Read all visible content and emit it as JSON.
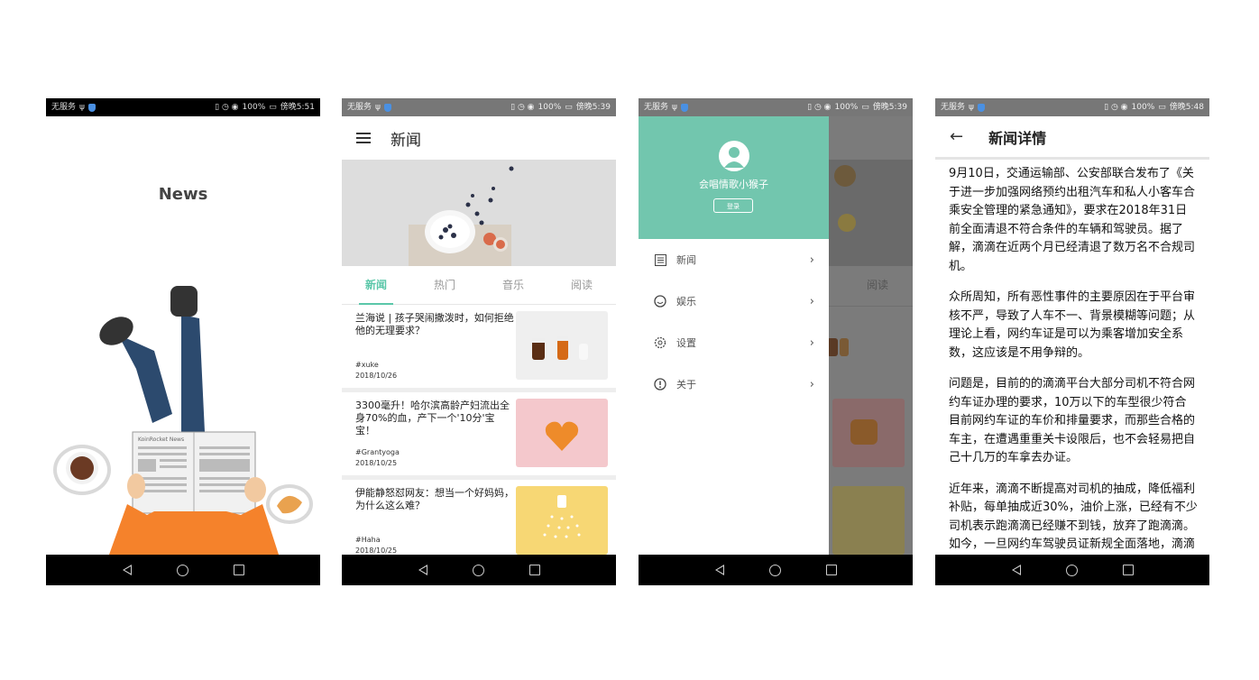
{
  "screens": {
    "splash": {
      "status": {
        "left": "无服务",
        "right": "100%",
        "time": "傍晚5:51"
      },
      "title": "News",
      "illustration_text": "KoinRocket News"
    },
    "news_list": {
      "status": {
        "left": "无服务",
        "right": "100%",
        "time": "傍晚5:39"
      },
      "title": "新闻",
      "tabs": [
        "新闻",
        "热门",
        "音乐",
        "阅读"
      ],
      "items": [
        {
          "title": "兰海说 | 孩子哭闹撒泼时，如何拒绝他的无理要求？",
          "tag": "#xuke",
          "date": "2018/10/26"
        },
        {
          "title": "3300毫升！哈尔滨高龄产妇流出全身70%的血，产下一个'10分'宝宝！",
          "tag": "#Grantyoga",
          "date": "2018/10/25"
        },
        {
          "title": "伊能静怒怼网友：想当一个好妈妈，为什么这么难？",
          "tag": "#Haha",
          "date": "2018/10/25"
        }
      ]
    },
    "drawer": {
      "status": {
        "left": "无服务",
        "right": "100%",
        "time": "傍晚5:39"
      },
      "username": "会唱情歌小猴子",
      "login": "登录",
      "menu": [
        {
          "label": "新闻",
          "icon": "list-icon"
        },
        {
          "label": "娱乐",
          "icon": "smile-icon"
        },
        {
          "label": "设置",
          "icon": "gear-icon"
        },
        {
          "label": "关于",
          "icon": "info-icon"
        }
      ],
      "background_tab": "阅读"
    },
    "detail": {
      "status": {
        "left": "无服务",
        "right": "100%",
        "time": "傍晚5:48"
      },
      "title": "新闻详情",
      "paragraphs": [
        "9月10日，交通运输部、公安部联合发布了《关于进一步加强网络预约出租汽车和私人小客车合乘安全管理的紧急通知》，要求在2018年31日前全面清退不符合条件的车辆和驾驶员。据了解，滴滴在近两个月已经清退了数万名不合规司机。",
        "众所周知，所有恶性事件的主要原因在于平台审核不严，导致了人车不一、背景模糊等问题；从理论上看，网约车证是可以为乘客增加安全系数，这应该是不用争辩的。",
        "问题是，目前的的滴滴平台大部分司机不符合网约车证办理的要求，10万以下的车型很少符合目前网约车证的车价和排量要求，而那些合格的车主，在遭遇重重关卡设限后，也不会轻易把自己十几万的车拿去办证。",
        "近年来，滴滴不断提高对司机的抽成，降低福利补贴，每单抽成近30%，油价上涨，已经有不少司机表示跑滴滴已经赚不到钱，放弃了跑滴滴。如今，一旦网约车驾驶员证新规全面落地，滴滴或将迎来"
      ]
    }
  },
  "colors": {
    "accent": "#5bc7a9",
    "drawer_header": "#72c6ae"
  }
}
